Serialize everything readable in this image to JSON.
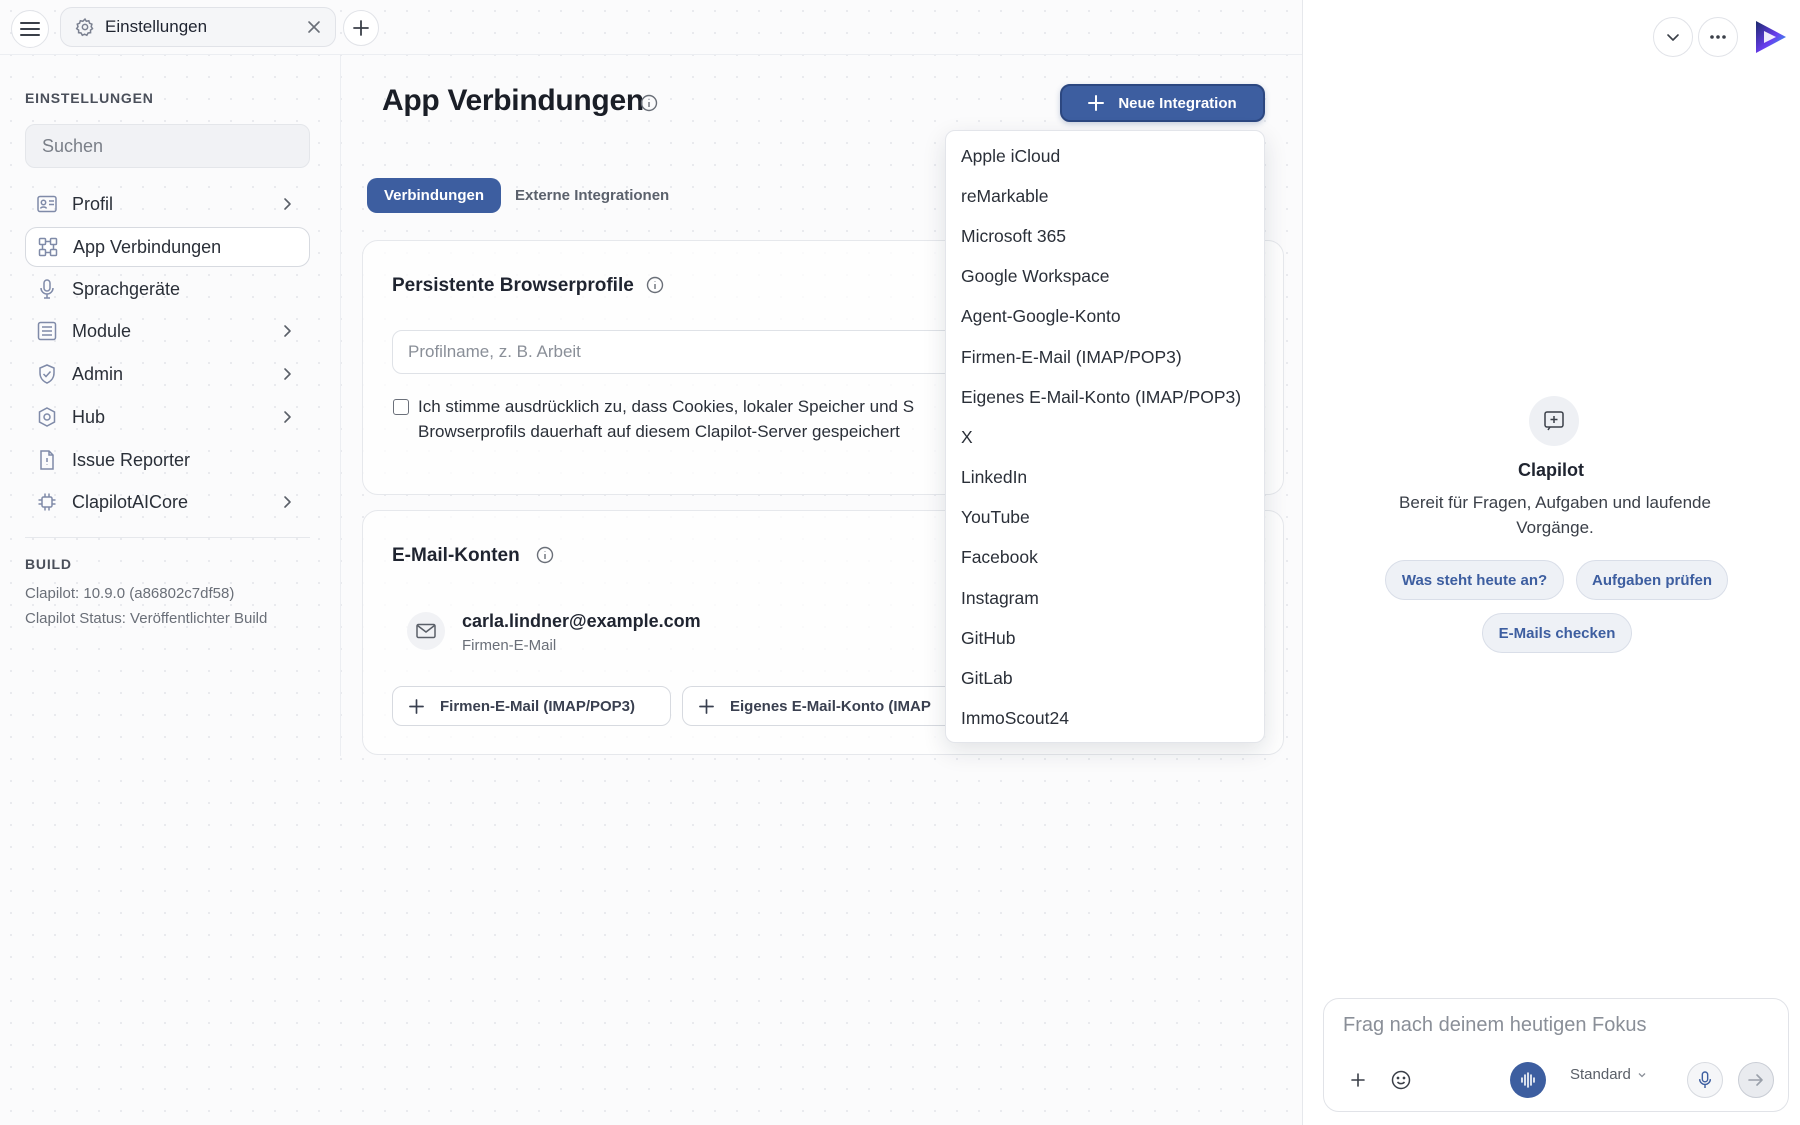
{
  "tabbar": {
    "tab_label": "Einstellungen"
  },
  "sidebar": {
    "heading": "EINSTELLUNGEN",
    "search_placeholder": "Suchen",
    "items": [
      {
        "label": "Profil",
        "icon": "profile-card-icon",
        "has_submenu": true
      },
      {
        "label": "App Verbindungen",
        "icon": "connections-icon",
        "has_submenu": false,
        "active": true
      },
      {
        "label": "Sprachgeräte",
        "icon": "microphone-icon",
        "has_submenu": false
      },
      {
        "label": "Module",
        "icon": "modules-icon",
        "has_submenu": true
      },
      {
        "label": "Admin",
        "icon": "shield-icon",
        "has_submenu": true
      },
      {
        "label": "Hub",
        "icon": "hub-icon",
        "has_submenu": true
      },
      {
        "label": "Issue Reporter",
        "icon": "document-icon",
        "has_submenu": false
      },
      {
        "label": "ClapilotAICore",
        "icon": "chip-icon",
        "has_submenu": true
      }
    ],
    "build_heading": "BUILD",
    "build_version": "Clapilot: 10.9.0 (a86802c7df58)",
    "build_status": "Clapilot Status: Veröffentlichter Build"
  },
  "main": {
    "title": "App Verbindungen",
    "new_integration_label": "Neue Integration",
    "tabs": [
      {
        "label": "Verbindungen",
        "active": true
      },
      {
        "label": "Externe Integrationen",
        "active": false
      }
    ],
    "browser_profiles": {
      "title": "Persistente Browserprofile",
      "input_placeholder": "Profilname, z. B. Arbeit",
      "consent_line1": "Ich stimme ausdrücklich zu, dass Cookies, lokaler Speicher und S",
      "consent_line2": "Browserprofils dauerhaft auf diesem Clapilot-Server gespeichert"
    },
    "email_accounts": {
      "title": "E-Mail-Konten",
      "account_address": "carla.lindner@example.com",
      "account_type": "Firmen-E-Mail",
      "add_company_label": "Firmen-E-Mail (IMAP/POP3)",
      "add_own_label": "Eigenes E-Mail-Konto (IMAP"
    }
  },
  "dropdown": {
    "items": [
      "Apple iCloud",
      "reMarkable",
      "Microsoft 365",
      "Google Workspace",
      "Agent-Google-Konto",
      "Firmen-E-Mail (IMAP/POP3)",
      "Eigenes E-Mail-Konto (IMAP/POP3)",
      "X",
      "LinkedIn",
      "YouTube",
      "Facebook",
      "Instagram",
      "GitHub",
      "GitLab",
      "ImmoScout24"
    ]
  },
  "assistant": {
    "name": "Clapilot",
    "subtitle": "Bereit für Fragen, Aufgaben und laufende Vorgänge.",
    "chips": [
      "Was steht heute an?",
      "Aufgaben prüfen",
      "E-Mails checken"
    ],
    "composer_placeholder": "Frag nach deinem heutigen Fokus",
    "mode": "Standard"
  },
  "colors": {
    "accent": "#3d5ea0",
    "accent_border": "#2c4780",
    "text": "#1f2430",
    "muted": "#6a6f78"
  }
}
